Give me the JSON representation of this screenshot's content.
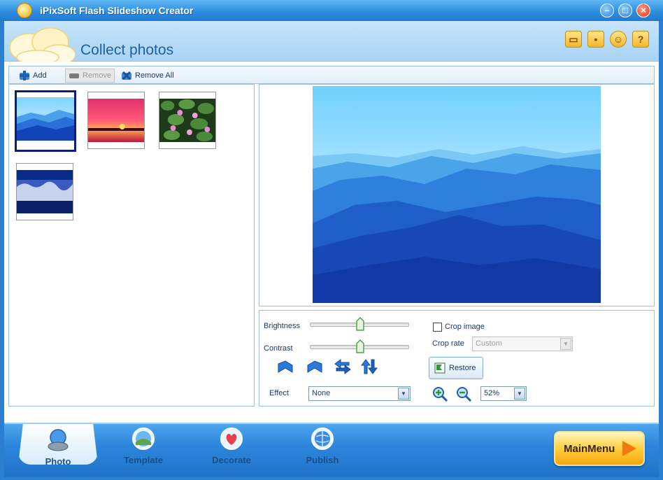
{
  "window": {
    "title": "iPixSoft Flash Slideshow Creator"
  },
  "header": {
    "title": "Collect photos",
    "icons": [
      "folder-icon",
      "save-icon",
      "user-icon",
      "help-icon"
    ]
  },
  "toolbar": {
    "add_label": "Add",
    "remove_label": "Remove",
    "remove_all_label": "Remove All"
  },
  "thumbnails": [
    {
      "name": "blue-mountains",
      "selected": true
    },
    {
      "name": "sunset",
      "selected": false
    },
    {
      "name": "water-lilies",
      "selected": false
    },
    {
      "name": "winter-forest",
      "selected": false
    }
  ],
  "controls": {
    "brightness_label": "Brightness",
    "brightness_value": 0.5,
    "contrast_label": "Contrast",
    "contrast_value": 0.5,
    "effect_label": "Effect",
    "effect_value": "None",
    "crop_label": "Crop image",
    "crop_checked": false,
    "crop_rate_label": "Crop rate",
    "crop_rate_value": "Custom",
    "restore_label": "Restore",
    "zoom_value": "52%"
  },
  "bottom_tabs": [
    {
      "label": "Photo",
      "active": true
    },
    {
      "label": "Template",
      "active": false
    },
    {
      "label": "Decorate",
      "active": false
    },
    {
      "label": "Publish",
      "active": false
    }
  ],
  "main_menu_label": "MainMenu"
}
